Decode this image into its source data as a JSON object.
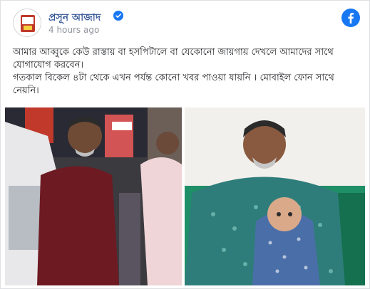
{
  "post": {
    "author": "প্রসূন আজাদ",
    "timestamp": "4 hours ago",
    "verified_icon": "verified-badge-icon",
    "platform_icon": "facebook-icon",
    "text_lines": [
      "আমার আব্বুকে কেউ রাস্তায় বা হসপিটালে বা যেকোনো জায়গায় দেখলে আমাদের সাথে যোগাযোগ করবেন।",
      "গতকাল বিকেল ৪টা থেকে এখন পর্যন্ত কোনো খবর পাওয়া যায়নি । মোবাইল ফোন সাথে নেয়নি।"
    ],
    "photos": [
      {
        "name": "man-on-street-photo"
      },
      {
        "name": "man-with-child-photo"
      }
    ]
  },
  "colors": {
    "author": "#385898",
    "timestamp": "#90949c",
    "text": "#1c1e21",
    "facebook_blue": "#1877f2"
  }
}
